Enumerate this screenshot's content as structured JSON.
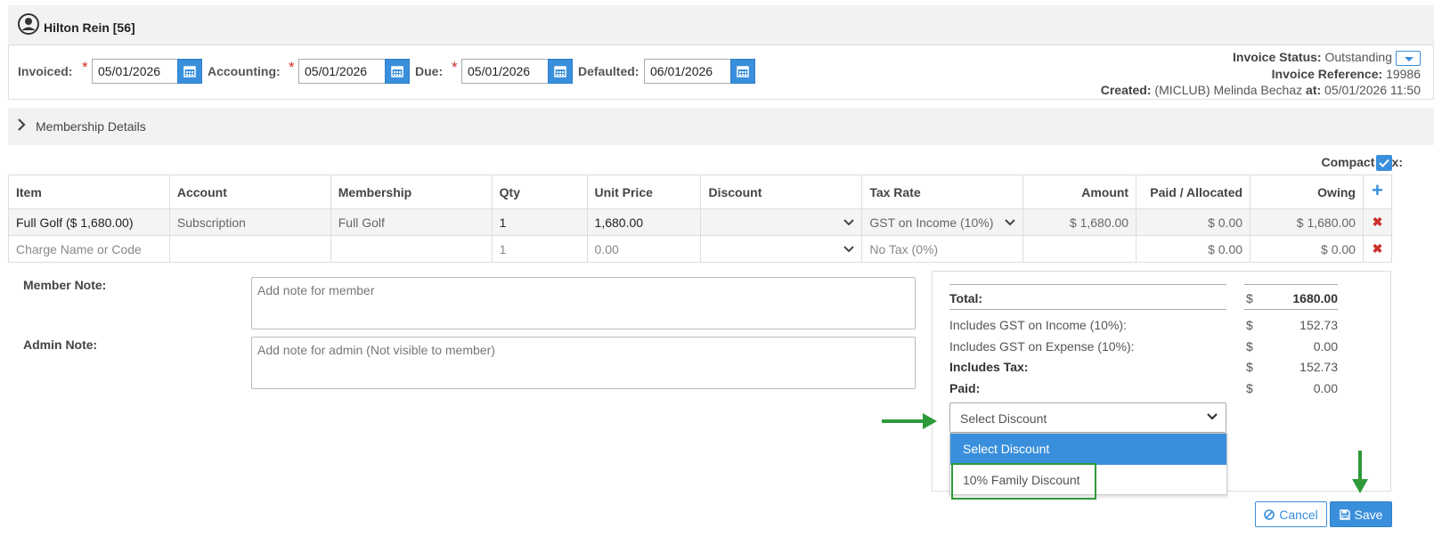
{
  "header": {
    "member_name": "Hilton Rein [56]"
  },
  "dates": {
    "invoiced_label": "Invoiced:",
    "invoiced_value": "05/01/2026",
    "accounting_label": "Accounting:",
    "accounting_value": "05/01/2026",
    "due_label": "Due:",
    "due_value": "05/01/2026",
    "defaulted_label": "Defaulted:",
    "defaulted_value": "06/01/2026",
    "required_mark": "*"
  },
  "invoice_info": {
    "status_label": "Invoice Status:",
    "status_value": "Outstanding",
    "reference_label": "Invoice Reference:",
    "reference_value": "19986",
    "created_label": "Created:",
    "created_by": "(MICLUB) Melinda Bechaz",
    "at_label": "at:",
    "created_at": "05/01/2026 11:50"
  },
  "membership_details": {
    "label": "Membership Details"
  },
  "compact_tax": {
    "label": "Compact Tax:",
    "checked": true
  },
  "table": {
    "headers": [
      "Item",
      "Account",
      "Membership",
      "Qty",
      "Unit Price",
      "Discount",
      "Tax Rate",
      "Amount",
      "Paid / Allocated",
      "Owing"
    ],
    "rows": [
      {
        "item": "Full Golf ($ 1,680.00)",
        "account": "Subscription",
        "membership": "Full Golf",
        "qty": "1",
        "unit_price": "1,680.00",
        "discount": "",
        "tax_rate": "GST on Income (10%)",
        "amount": "$ 1,680.00",
        "paid": "$ 0.00",
        "owing": "$ 1,680.00"
      },
      {
        "item": "Charge Name or Code",
        "account": "",
        "membership": "",
        "qty": "1",
        "unit_price": "0.00",
        "discount": "",
        "tax_rate": "No Tax (0%)",
        "amount": "",
        "paid": "$ 0.00",
        "owing": "$ 0.00"
      }
    ]
  },
  "notes": {
    "member_label": "Member Note:",
    "member_placeholder": "Add note for member",
    "admin_label": "Admin Note:",
    "admin_placeholder": "Add note for admin (Not visible to member)"
  },
  "totals": {
    "currency": "$",
    "total_label": "Total:",
    "total_value": "1680.00",
    "gst_income_label": "Includes GST on Income (10%):",
    "gst_income_value": "152.73",
    "gst_expense_label": "Includes GST on Expense (10%):",
    "gst_expense_value": "0.00",
    "tax_label": "Includes Tax:",
    "tax_value": "152.73",
    "paid_label": "Paid:",
    "paid_value": "0.00"
  },
  "discount_select": {
    "selected": "Select Discount",
    "options": [
      "Select Discount",
      "10% Family Discount"
    ]
  },
  "buttons": {
    "cancel": "Cancel",
    "save": "Save"
  },
  "colors": {
    "accent": "#3a8fdc",
    "annotation_green": "#2e9a3a",
    "delete_red": "#c9302c"
  }
}
